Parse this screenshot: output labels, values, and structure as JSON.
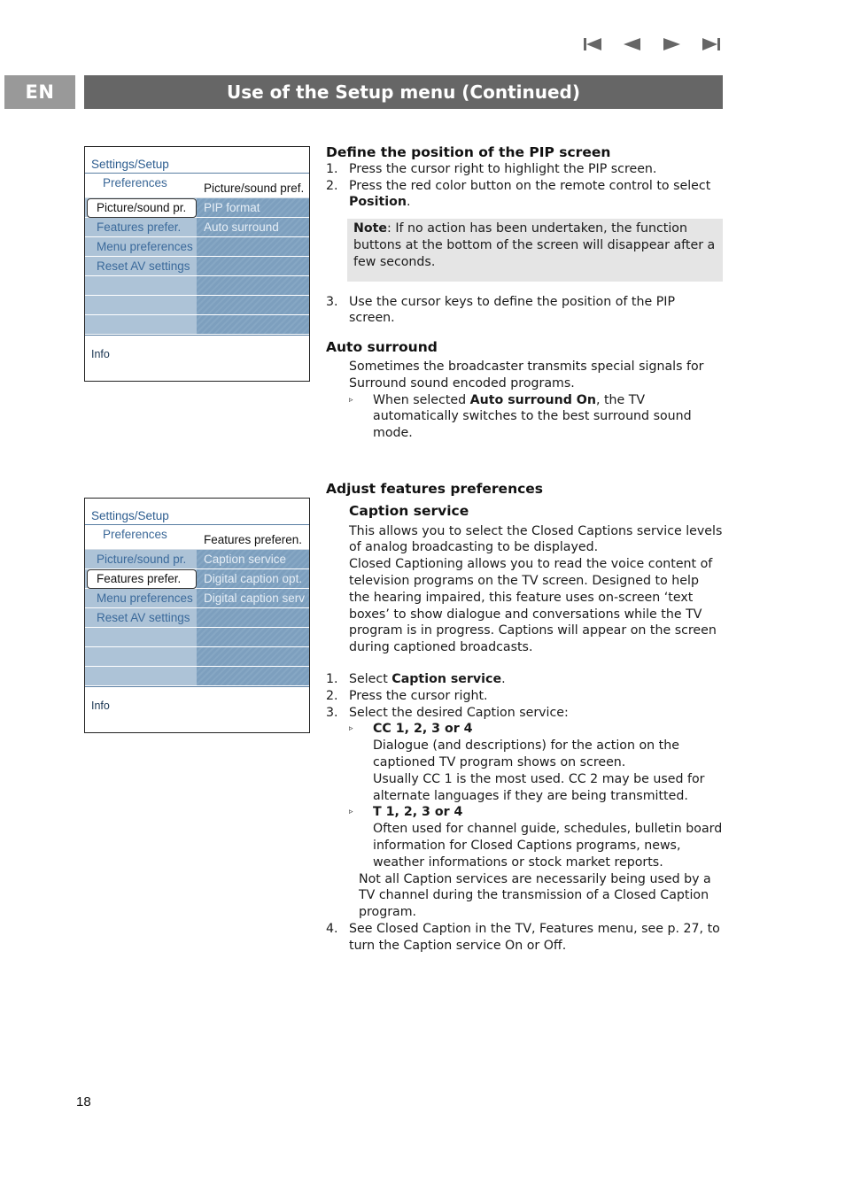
{
  "nav": {
    "icons": [
      "first-page-icon",
      "previous-page-icon",
      "next-page-icon",
      "last-page-icon"
    ]
  },
  "header": {
    "lang": "EN",
    "title": "Use of the Setup menu (Continued)"
  },
  "menus": [
    {
      "breadcrumb": "Settings/Setup",
      "left_header": "Preferences",
      "right_header": "Picture/sound pref.",
      "rows": [
        {
          "left": "Picture/sound pr.",
          "right": "PIP format",
          "selected": true
        },
        {
          "left": "Features prefer.",
          "right": "Auto surround",
          "selected": false
        },
        {
          "left": "Menu preferences",
          "right": "",
          "selected": false
        },
        {
          "left": "Reset AV settings",
          "right": "",
          "selected": false
        },
        {
          "left": "",
          "right": "",
          "selected": false
        },
        {
          "left": "",
          "right": "",
          "selected": false
        },
        {
          "left": "",
          "right": "",
          "selected": false
        }
      ],
      "info": "Info"
    },
    {
      "breadcrumb": "Settings/Setup",
      "left_header": "Preferences",
      "right_header": "Features preferen.",
      "rows": [
        {
          "left": "Picture/sound pr.",
          "right": "Caption service",
          "selected": false
        },
        {
          "left": "Features prefer.",
          "right": "Digital caption opt.",
          "selected": true
        },
        {
          "left": "Menu preferences",
          "right": "Digital caption serv",
          "selected": false
        },
        {
          "left": "Reset AV settings",
          "right": "",
          "selected": false
        },
        {
          "left": "",
          "right": "",
          "selected": false
        },
        {
          "left": "",
          "right": "",
          "selected": false
        },
        {
          "left": "",
          "right": "",
          "selected": false
        }
      ],
      "info": "Info"
    }
  ],
  "pip": {
    "heading": "Define the position of the PIP screen",
    "step1_num": "1.",
    "step1": "Press the cursor right to highlight the PIP screen.",
    "step2_num": "2.",
    "step2_pre": "Press the red color button on the remote control to select ",
    "step2_bold": "Position",
    "step2_post": ".",
    "note_bold": "Note",
    "note_text": ": If no action has been undertaken, the function buttons at the bottom of the screen will disappear after a few seconds.",
    "step3_num": "3.",
    "step3": "Use the cursor keys to define the position of the PIP screen."
  },
  "auto_surround": {
    "heading": "Auto surround",
    "body": "Sometimes the broadcaster transmits special signals for Surround sound encoded programs.",
    "bullet_marker": "▹",
    "bullet_pre": "When selected ",
    "bullet_bold": "Auto surround On",
    "bullet_post": ", the TV automatically switches to the best surround sound mode."
  },
  "features": {
    "heading": "Adjust features preferences",
    "subheading": "Caption service",
    "para1": "This allows you to select the Closed Captions service levels of analog broadcasting to be displayed.",
    "para2": "Closed Captioning allows you to read the voice content of television programs on the TV screen. Designed to help the hearing impaired, this feature uses on-screen ‘text boxes’ to show dialogue and conversations while the TV program is in progress. Captions will appear on the screen during captioned broadcasts.",
    "step1_num": "1.",
    "step1_pre": "Select ",
    "step1_bold": "Caption service",
    "step1_post": ".",
    "step2_num": "2.",
    "step2": "Press the cursor right.",
    "step3_num": "3.",
    "step3": "Select the desired Caption service:",
    "bullet_marker": "▹",
    "cc_title": "CC 1, 2, 3 or 4",
    "cc_text1": "Dialogue (and descriptions) for the action on the captioned TV program shows on screen.",
    "cc_text2": "Usually CC 1 is the most used. CC 2 may be used for alternate languages if they are being transmitted.",
    "t_title": "T 1, 2, 3 or 4",
    "t_text": "Often used for channel guide, schedules, bulletin board information for Closed Captions programs, news, weather informations or stock market reports.",
    "not_all": "Not all Caption services are necessarily being used by a TV channel during the transmission of a Closed Caption program.",
    "step4_num": "4.",
    "step4": "See Closed Caption in the TV, Features menu, see p. 27, to turn the Caption service On or Off."
  },
  "footer": {
    "page_number": "18"
  }
}
